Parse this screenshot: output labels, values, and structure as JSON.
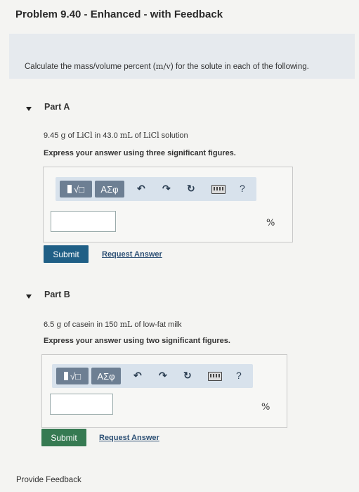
{
  "header": {
    "title": "Problem 9.40 - Enhanced - with Feedback"
  },
  "intro": {
    "text_before": "Calculate the mass/volume percent (",
    "text_math": "m/v",
    "text_after": ") for the solute in each of the following."
  },
  "partA": {
    "label": "Part A",
    "q_num": "9.45",
    "q_g": "g",
    "q_of": "of",
    "q_licl": "LiCl",
    "q_in": "in 43.0",
    "q_ml": "mL",
    "q_of2": "of",
    "q_licl2": "LiCl",
    "q_sol": "solution",
    "instruction": "Express your answer using three significant figures.",
    "toolbar": {
      "sqrt_label": "√□",
      "greek_label": "ΑΣφ",
      "help_label": "?"
    },
    "unit": "%",
    "submit_label": "Submit",
    "request_label": "Request Answer",
    "submit_color": "#1f5f86"
  },
  "partB": {
    "label": "Part B",
    "q_num": "6.5",
    "q_g": "g",
    "q_mid": "of casein in 150",
    "q_ml": "mL",
    "q_end": "of low-fat milk",
    "instruction": "Express your answer using two significant figures.",
    "toolbar": {
      "sqrt_label": "√□",
      "greek_label": "ΑΣφ",
      "help_label": "?"
    },
    "unit": "%",
    "submit_label": "Submit",
    "request_label": "Request Answer",
    "submit_color": "#367a52"
  },
  "footer": {
    "feedback_label": "Provide Feedback"
  }
}
